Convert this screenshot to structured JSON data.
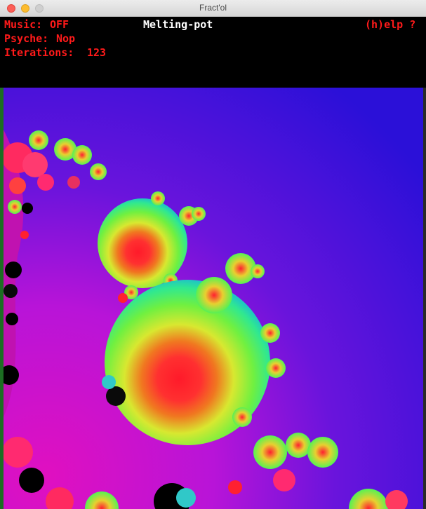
{
  "window": {
    "title": "Fract'ol"
  },
  "hud": {
    "music_label": "Music:",
    "music_value": "OFF",
    "psyche_label": "Psyche:",
    "psyche_value": "Nop",
    "iterations_label": "Iterations:",
    "iterations_value": "123",
    "fractal_name": "Melting-pot",
    "help_label": "(h)elp ?"
  },
  "colors": {
    "hud_text": "#ff1a1a",
    "title_text": "#ffffff",
    "background_blue": "#2a14d8",
    "background_magenta": "#d010c8"
  }
}
